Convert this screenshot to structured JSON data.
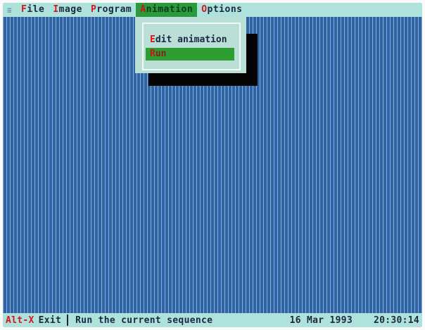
{
  "menubar": {
    "system_icon": "≡",
    "items": [
      {
        "hotkey": "F",
        "rest": "ile"
      },
      {
        "hotkey": "I",
        "rest": "mage"
      },
      {
        "hotkey": "P",
        "rest": "rogram"
      },
      {
        "hotkey": "A",
        "rest": "nimation",
        "active": true
      },
      {
        "hotkey": "O",
        "rest": "ptions"
      }
    ]
  },
  "dropdown": {
    "items": [
      {
        "hotkey": "E",
        "rest": "dit animation"
      },
      {
        "hotkey": "R",
        "rest": "un",
        "selected": true
      }
    ]
  },
  "statusbar": {
    "exit_key": "Alt-X",
    "exit_label": "Exit",
    "message": "Run the current sequence",
    "date": "16 Mar 1993",
    "time": "20:30:14"
  },
  "colors": {
    "desktop": "#2c64a6",
    "menubar": "#aee2db",
    "highlight": "#2e9d32",
    "hotkey": "#d8141c"
  }
}
